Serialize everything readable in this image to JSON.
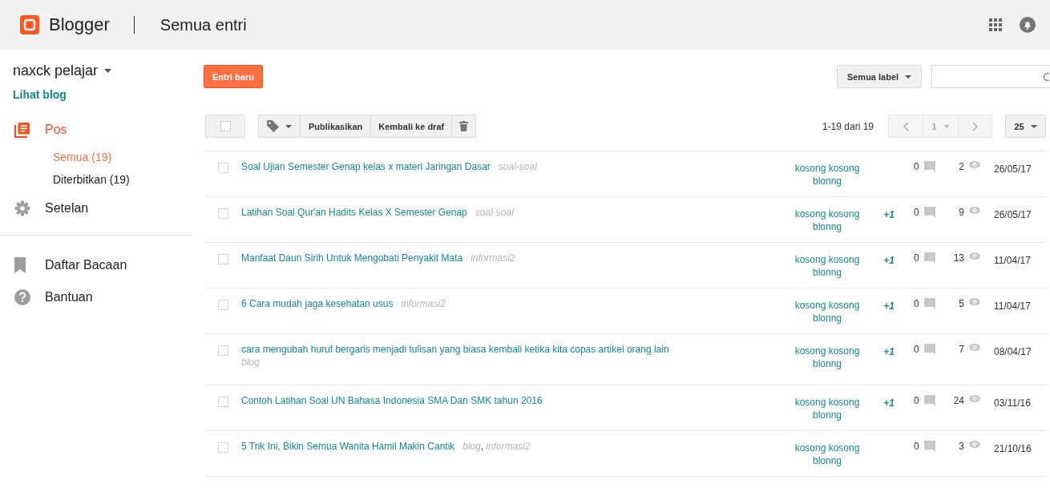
{
  "header": {
    "brand": "Blogger",
    "title": "Semua entri"
  },
  "sidebar": {
    "blog_name": "naxck pelajar",
    "view_blog": "Lihat blog",
    "items": [
      {
        "kind": "posts",
        "label": "Pos",
        "selected": true
      },
      {
        "kind": "sub",
        "label": "Semua (19)",
        "selected": true
      },
      {
        "kind": "sub",
        "label": "Diterbitkan (19)",
        "selected": false
      },
      {
        "kind": "settings",
        "label": "Setelan",
        "selected": false
      },
      {
        "kind": "divider"
      },
      {
        "kind": "reading",
        "label": "Daftar Bacaan",
        "selected": false
      },
      {
        "kind": "help",
        "label": "Bantuan",
        "selected": false
      }
    ]
  },
  "toolbar": {
    "new_post": "Entri baru",
    "label_filter": "Semua label",
    "publish": "Publikasikan",
    "revert": "Kembali ke draf",
    "range": "1-19 dari 19",
    "page": "1",
    "page_size": "25"
  },
  "posts": [
    {
      "title": "Soal Ujian Semester Genap kelas x materi Jaringan Dasar",
      "labels": [
        "soal-soal"
      ],
      "author": "kosong kosong blonng",
      "checked": false,
      "comments": "0",
      "views": "2",
      "date": "26/05/17"
    },
    {
      "title": "Latihan Soal Qur'an Hadits Kelas X Semester Genap",
      "labels": [
        "soal-soal"
      ],
      "author": "kosong kosong blonng",
      "plus_one": "+1",
      "checked": false,
      "comments": "0",
      "views": "9",
      "date": "26/05/17"
    },
    {
      "title": "Manfaat Daun Sirih Untuk Mengobati Penyakit Mata",
      "labels": [
        "informasi2"
      ],
      "author": "kosong kosong blonng",
      "plus_one": "+1",
      "checked": false,
      "comments": "0",
      "views": "13",
      "date": "11/04/17"
    },
    {
      "title": "6 Cara mudah jaga kesehatan usus",
      "labels": [
        "informasi2"
      ],
      "author": "kosong kosong blonng",
      "plus_one": "+1",
      "checked": false,
      "comments": "0",
      "views": "5",
      "date": "11/04/17"
    },
    {
      "title": "cara mengubah huruf bergaris menjadi tulisan yang biasa kembali ketika kita copas artikel orang lain",
      "labels": [
        "blog"
      ],
      "author": "kosong kosong blonng",
      "plus_one": "+1",
      "checked": false,
      "comments": "0",
      "views": "7",
      "date": "08/04/17"
    },
    {
      "title": "Contoh Latihan Soal UN Bahasa Indonesia SMA Dan SMK tahun 2016",
      "author": "kosong kosong blonng",
      "plus_one": "+1",
      "checked": false,
      "comments": "0",
      "views": "24",
      "date": "03/11/16"
    },
    {
      "title": "5 Trik Ini, Bikin Semua Wanita Hamil Makin Cantik",
      "labels": [
        "blog",
        "informasi2"
      ],
      "label_separator": ",",
      "author": "kosong kosong blonng",
      "checked": false,
      "comments": "0",
      "views": "3",
      "date": "21/10/16"
    }
  ]
}
